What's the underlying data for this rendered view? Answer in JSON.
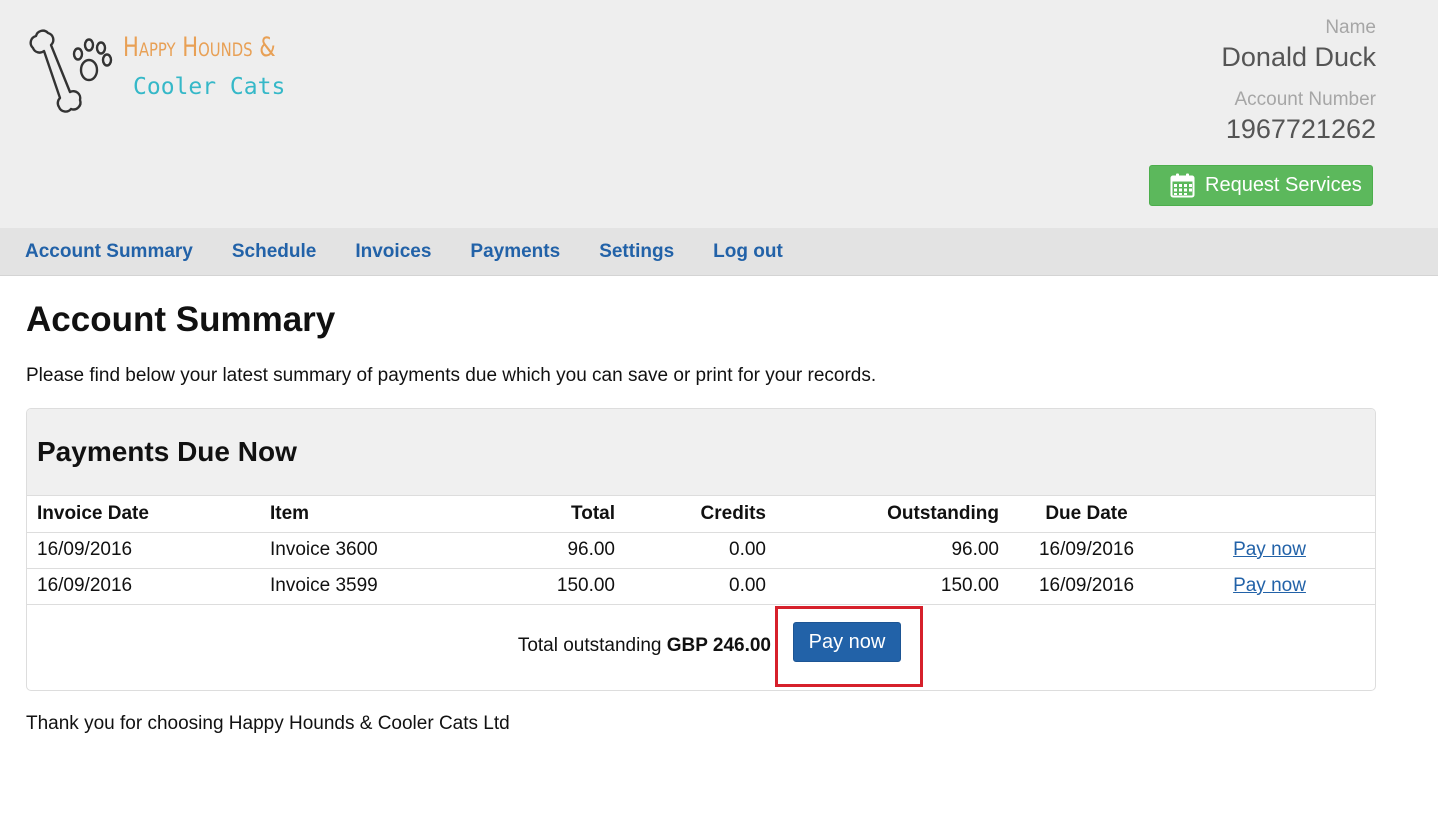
{
  "brand": {
    "line1": "Happy Hounds &",
    "line2": "Cooler Cats"
  },
  "account": {
    "name_label": "Name",
    "name_value": "Donald Duck",
    "number_label": "Account Number",
    "number_value": "1967721262",
    "request_button": "Request Services"
  },
  "nav": {
    "items": [
      "Account Summary",
      "Schedule",
      "Invoices",
      "Payments",
      "Settings",
      "Log out"
    ]
  },
  "page": {
    "title": "Account Summary",
    "intro": "Please find below your latest summary of payments due which you can save or print for your records.",
    "footer": "Thank you for choosing Happy Hounds & Cooler Cats Ltd"
  },
  "payments_panel": {
    "heading": "Payments Due Now",
    "columns": [
      "Invoice Date",
      "Item",
      "Total",
      "Credits",
      "Outstanding",
      "Due Date"
    ],
    "rows": [
      {
        "invoice_date": "16/09/2016",
        "item": "Invoice 3600",
        "total": "96.00",
        "credits": "0.00",
        "outstanding": "96.00",
        "due_date": "16/09/2016",
        "action": "Pay now"
      },
      {
        "invoice_date": "16/09/2016",
        "item": "Invoice 3599",
        "total": "150.00",
        "credits": "0.00",
        "outstanding": "150.00",
        "due_date": "16/09/2016",
        "action": "Pay now"
      }
    ],
    "total_label": "Total outstanding",
    "total_value": "GBP 246.00",
    "pay_button": "Pay now"
  },
  "colors": {
    "header_bg": "#eeeeee",
    "nav_link": "#2262a8",
    "request_button": "#5cb85c",
    "pay_button": "#2262a8",
    "highlight": "#d6202b",
    "brand_orange": "#e8a055",
    "brand_teal": "#35b8c8"
  },
  "icons": {
    "logo": "bone-paw-icon",
    "request": "calendar-icon"
  }
}
